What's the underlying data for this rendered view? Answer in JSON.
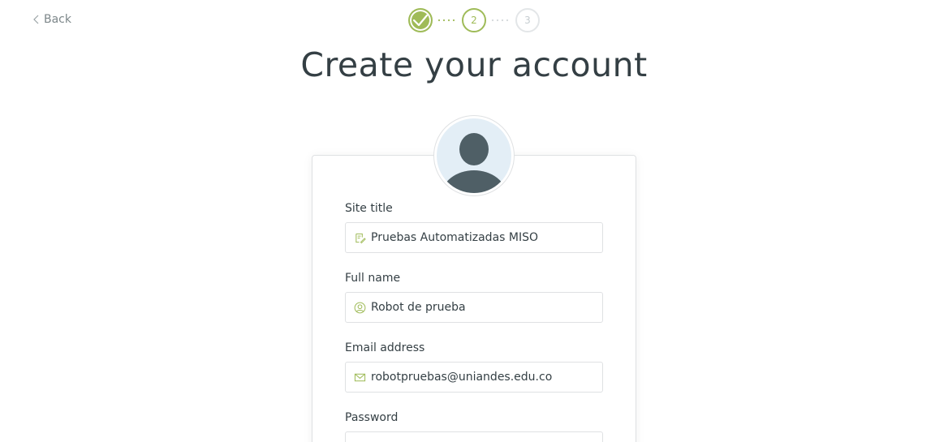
{
  "nav": {
    "back_label": "Back"
  },
  "steps": [
    {
      "state": "done",
      "label": ""
    },
    {
      "state": "active",
      "label": "2"
    },
    {
      "state": "todo",
      "label": "3"
    }
  ],
  "page": {
    "title": "Create your account"
  },
  "form": {
    "site_title": {
      "label": "Site title",
      "value": "Pruebas Automatizadas MISO",
      "icon": "pencil-doc-icon"
    },
    "full_name": {
      "label": "Full name",
      "value": "Robot de prueba",
      "icon": "user-circle-icon"
    },
    "email": {
      "label": "Email address",
      "value": "robotpruebas@uniandes.edu.co",
      "icon": "envelope-icon"
    },
    "password": {
      "label": "Password",
      "value": "",
      "icon": "lock-icon"
    }
  },
  "colors": {
    "accent": "#9fbb58",
    "text": "#343f44",
    "muted": "#7d878a",
    "border": "#dfe1e3"
  }
}
